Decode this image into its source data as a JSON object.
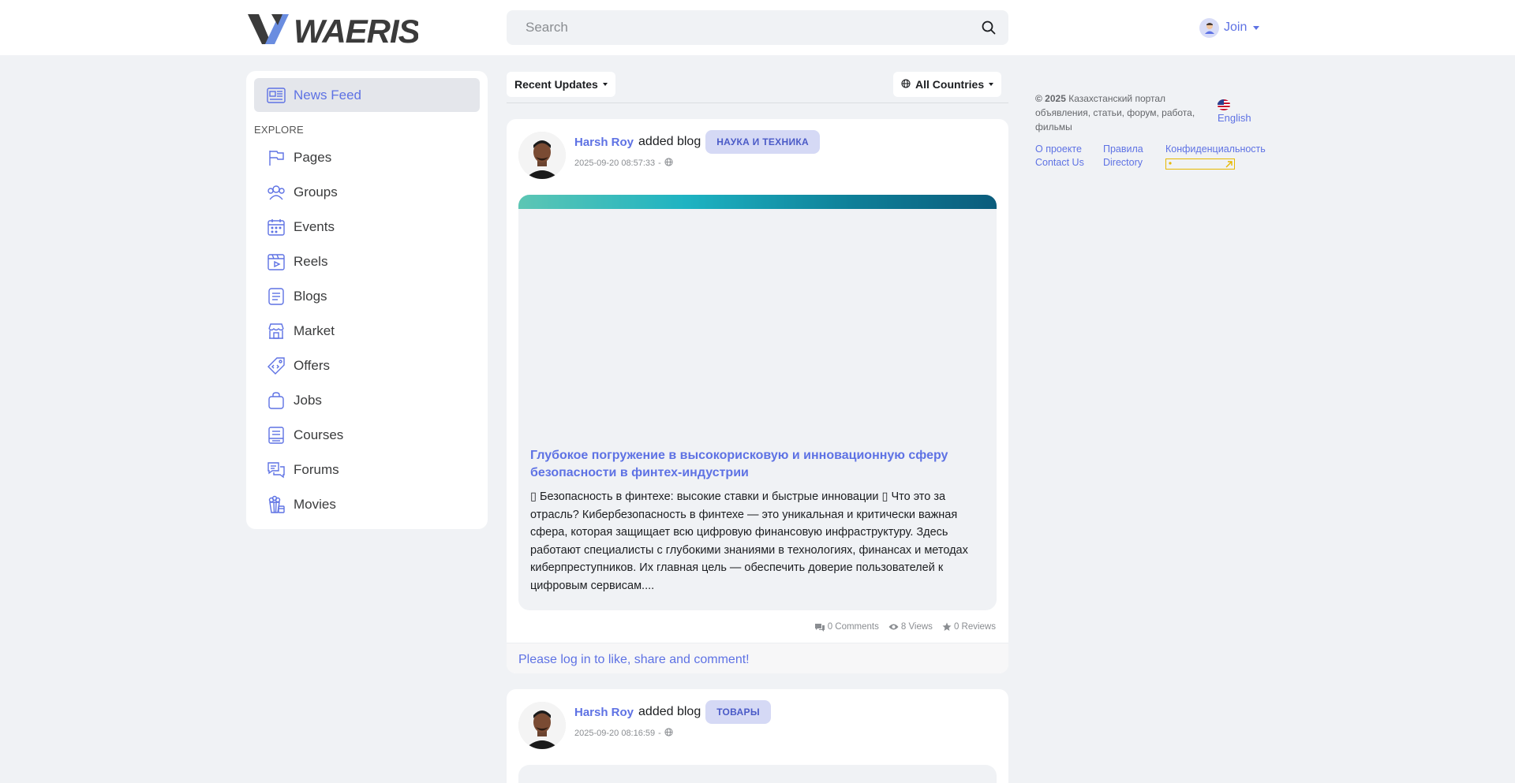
{
  "header": {
    "brand": "WAERIS",
    "search_placeholder": "Search",
    "join_label": "Join"
  },
  "sidebar": {
    "active": {
      "label": "News Feed",
      "icon": "newspaper-icon"
    },
    "section_label": "EXPLORE",
    "items": [
      {
        "label": "Pages",
        "icon": "flag-icon"
      },
      {
        "label": "Groups",
        "icon": "users-icon"
      },
      {
        "label": "Events",
        "icon": "calendar-icon"
      },
      {
        "label": "Reels",
        "icon": "clapperboard-icon"
      },
      {
        "label": "Blogs",
        "icon": "document-icon"
      },
      {
        "label": "Market",
        "icon": "store-icon"
      },
      {
        "label": "Offers",
        "icon": "tag-icon"
      },
      {
        "label": "Jobs",
        "icon": "briefcase-icon"
      },
      {
        "label": "Courses",
        "icon": "book-icon"
      },
      {
        "label": "Forums",
        "icon": "chat-icon"
      },
      {
        "label": "Movies",
        "icon": "popcorn-icon"
      }
    ]
  },
  "feed": {
    "sort_label": "Recent Updates",
    "country_label": "All Countries",
    "posts": [
      {
        "author": "Harsh Roy",
        "action": "added blog",
        "category": "НАУКА И ТЕХНИКА",
        "timestamp": "2025-09-20 08:57:33",
        "separator": "-",
        "title": "Глубокое погружение в высокорисковую и инновационную сферу безопасности в финтех-индустрии",
        "excerpt": "▯ Безопасность в финтехе: высокие ставки и быстрые инновации ▯ Что это за отрасль? Кибербезопасность в финтехе — это уникальная и критически важная сфера, которая защищает всю цифровую финансовую инфраструктуру. Здесь работают специалисты с глубокими знаниями в технологиях, финансах и методах киберпреступников. Их главная цель — обеспечить доверие пользователей к цифровым сервисам....",
        "comments": "0 Comments",
        "views": "8 Views",
        "reviews": "0 Reviews",
        "login_prompt": "Please log in to like, share and comment!"
      },
      {
        "author": "Harsh Roy",
        "action": "added blog",
        "category": "ТОВАРЫ",
        "timestamp": "2025-09-20 08:16:59",
        "separator": "-"
      }
    ]
  },
  "right": {
    "copyright_year": "© 2025",
    "copyright_text": "Казахстанский портал объявления, статьи, форум, работа, фильмы",
    "language": "English",
    "links": [
      "О проекте",
      "Правила",
      "Конфиденциальность",
      "Contact Us",
      "Directory"
    ]
  },
  "colors": {
    "accent": "#5e72e4",
    "page_bg": "#f0f2f5",
    "badge_bg": "#d5d9f5"
  }
}
